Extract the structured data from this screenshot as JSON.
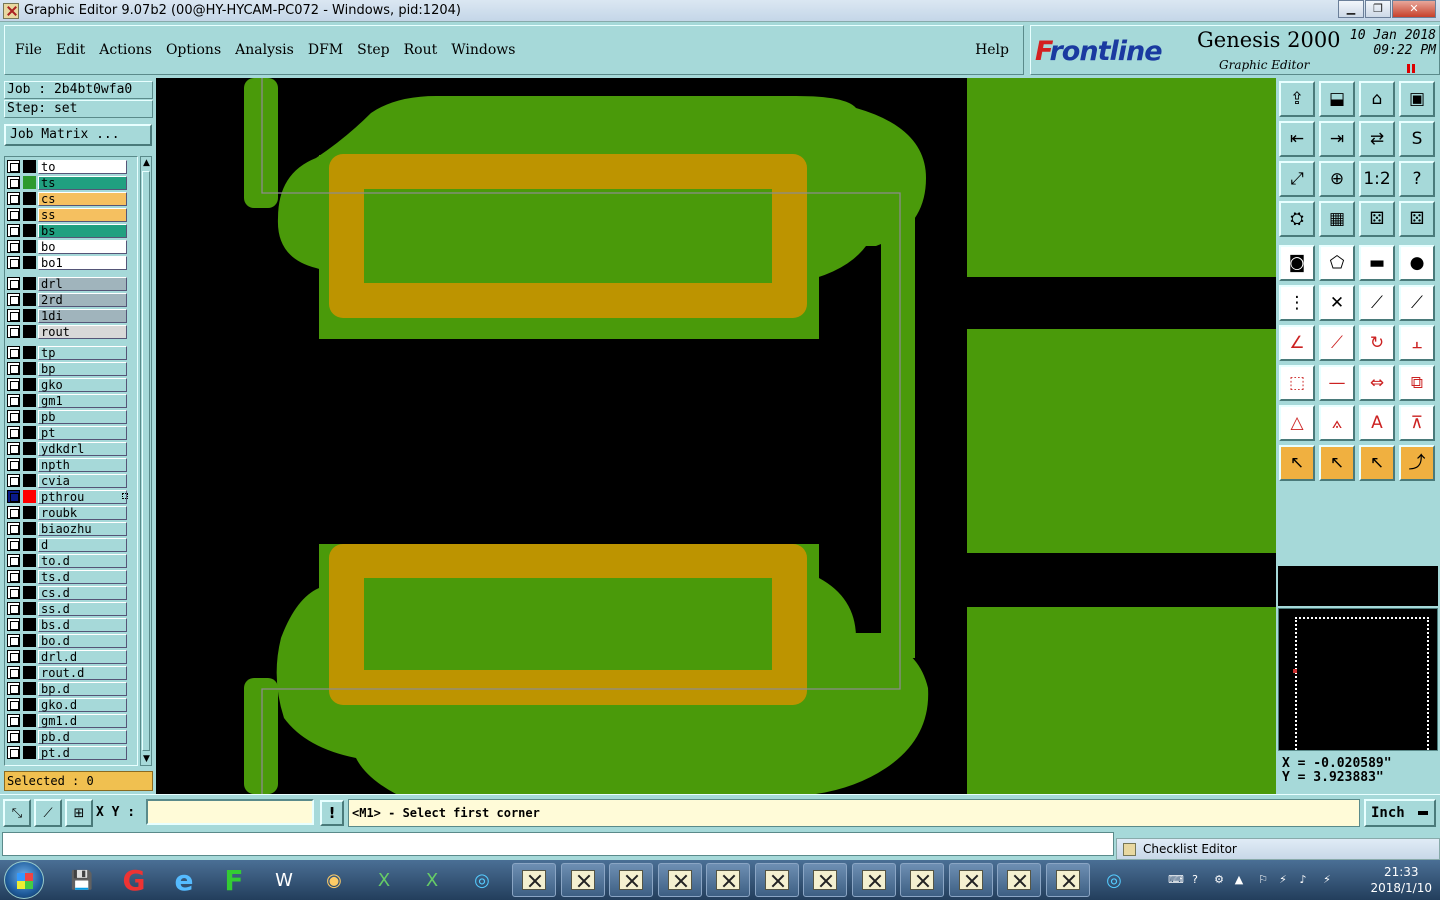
{
  "window": {
    "title": "Graphic Editor 9.07b2 (00@HY-HYCAM-PC072 - Windows, pid:1204)",
    "controls": [
      "minimize-icon",
      "maximize-icon",
      "close-icon"
    ]
  },
  "menu": {
    "items": [
      "File",
      "Edit",
      "Actions",
      "Options",
      "Analysis",
      "DFM",
      "Step",
      "Rout",
      "Windows"
    ],
    "help": "Help"
  },
  "brand": {
    "logo_prefix": "F",
    "logo_rest": "rontline",
    "product": "Genesis 2000",
    "subtitle": "Graphic Editor",
    "date_line1": "10 Jan 2018",
    "date_line2": "09:22 PM"
  },
  "job": {
    "job_label": "Job : 2b4bt0wfa0",
    "step_label": "Step: set",
    "matrix_button": "Job Matrix ..."
  },
  "layers": [
    {
      "name": "to",
      "swatch": "#000000",
      "bg": "#ffffff"
    },
    {
      "name": "ts",
      "swatch": "#2e9a2e",
      "bg": "#20a080"
    },
    {
      "name": "cs",
      "swatch": "#000000",
      "bg": "#f5c060"
    },
    {
      "name": "ss",
      "swatch": "#000000",
      "bg": "#f5c060"
    },
    {
      "name": "bs",
      "swatch": "#000000",
      "bg": "#20a080"
    },
    {
      "name": "bo",
      "swatch": "#000000",
      "bg": "#ffffff"
    },
    {
      "name": "bo1",
      "swatch": "#000000",
      "bg": "#ffffff"
    },
    {
      "name": "drl",
      "swatch": "#000000",
      "bg": "#a0b4bc"
    },
    {
      "name": "2rd",
      "swatch": "#000000",
      "bg": "#a0b4bc"
    },
    {
      "name": "1di",
      "swatch": "#000000",
      "bg": "#a0b4bc"
    },
    {
      "name": "rout",
      "swatch": "#000000",
      "bg": "#d8d8d8"
    },
    {
      "name": "tp",
      "swatch": "#000000",
      "bg": "#a6d9d9"
    },
    {
      "name": "bp",
      "swatch": "#000000",
      "bg": "#a6d9d9"
    },
    {
      "name": "gko",
      "swatch": "#000000",
      "bg": "#a6d9d9"
    },
    {
      "name": "gm1",
      "swatch": "#000000",
      "bg": "#a6d9d9"
    },
    {
      "name": "pb",
      "swatch": "#000000",
      "bg": "#a6d9d9"
    },
    {
      "name": "pt",
      "swatch": "#000000",
      "bg": "#a6d9d9"
    },
    {
      "name": "ydkdrl",
      "swatch": "#000000",
      "bg": "#a6d9d9"
    },
    {
      "name": "npth",
      "swatch": "#000000",
      "bg": "#a6d9d9"
    },
    {
      "name": "cvia",
      "swatch": "#000000",
      "bg": "#a6d9d9"
    },
    {
      "name": "pthrou",
      "swatch": "#ff0000",
      "bg": "#a6d9d9",
      "active": true
    },
    {
      "name": "roubk",
      "swatch": "#000000",
      "bg": "#a6d9d9"
    },
    {
      "name": "biaozhu",
      "swatch": "#000000",
      "bg": "#a6d9d9"
    },
    {
      "name": "d",
      "swatch": "#000000",
      "bg": "#a6d9d9"
    },
    {
      "name": "to.d",
      "swatch": "#000000",
      "bg": "#a6d9d9"
    },
    {
      "name": "ts.d",
      "swatch": "#000000",
      "bg": "#a6d9d9"
    },
    {
      "name": "cs.d",
      "swatch": "#000000",
      "bg": "#a6d9d9"
    },
    {
      "name": "ss.d",
      "swatch": "#000000",
      "bg": "#a6d9d9"
    },
    {
      "name": "bs.d",
      "swatch": "#000000",
      "bg": "#a6d9d9"
    },
    {
      "name": "bo.d",
      "swatch": "#000000",
      "bg": "#a6d9d9"
    },
    {
      "name": "drl.d",
      "swatch": "#000000",
      "bg": "#a6d9d9"
    },
    {
      "name": "rout.d",
      "swatch": "#000000",
      "bg": "#a6d9d9"
    },
    {
      "name": "bp.d",
      "swatch": "#000000",
      "bg": "#a6d9d9"
    },
    {
      "name": "gko.d",
      "swatch": "#000000",
      "bg": "#a6d9d9"
    },
    {
      "name": "gm1.d",
      "swatch": "#000000",
      "bg": "#a6d9d9"
    },
    {
      "name": "pb.d",
      "swatch": "#000000",
      "bg": "#a6d9d9"
    },
    {
      "name": "pt.d",
      "swatch": "#000000",
      "bg": "#a6d9d9"
    }
  ],
  "selected_label": "Selected : 0",
  "coordinates": {
    "x_text": "X = -0.020589\"",
    "y_text": "Y = 3.923883\""
  },
  "command": {
    "xy_label": "X Y :",
    "xy_value": "",
    "prompt": "<M1> - Select first corner",
    "units": "Inch"
  },
  "checklist_title": "Checklist Editor",
  "clock": {
    "time": "21:33",
    "date": "2018/1/10"
  },
  "colors": {
    "panel": "#a6d9d9",
    "copper_green": "#4a9a0a",
    "pad_gold": "#bd9400",
    "canvas": "#000000"
  },
  "tools": [
    "open-step-icon",
    "save-icon",
    "home-icon",
    "window-icon",
    "import-icon",
    "export-icon",
    "mirror-icon",
    "snap-icon",
    "zoom-fit-icon",
    "zoom-center-icon",
    "scale-1-2-icon",
    "help-icon",
    "measure-tool-icon",
    "grid-icon",
    "layer-compare-icon",
    "layer-compare-red-icon",
    "pad-icon",
    "polygon-icon",
    "ruler-icon",
    "circle-icon",
    "connect-icon",
    "cross-icon",
    "line-icon",
    "arc-icon",
    "angle-icon",
    "slash-icon",
    "rotate-icon",
    "fit-icon",
    "move-icon",
    "minus-icon",
    "resize-icon",
    "copy-icon",
    "triangle-a-icon",
    "triangle-b-icon",
    "triangle-c-icon",
    "triangle-d-icon",
    "select-icon",
    "select-box-icon",
    "select-circle-icon",
    "select-route-icon"
  ],
  "taskbar_apps": [
    "start-icon",
    "save-disk-icon",
    "acrobat-icon",
    "internet-explorer-icon",
    "app-f-icon",
    "word-icon",
    "shell-icon",
    "excel-icon",
    "excel-icon-2",
    "eye-icon"
  ]
}
